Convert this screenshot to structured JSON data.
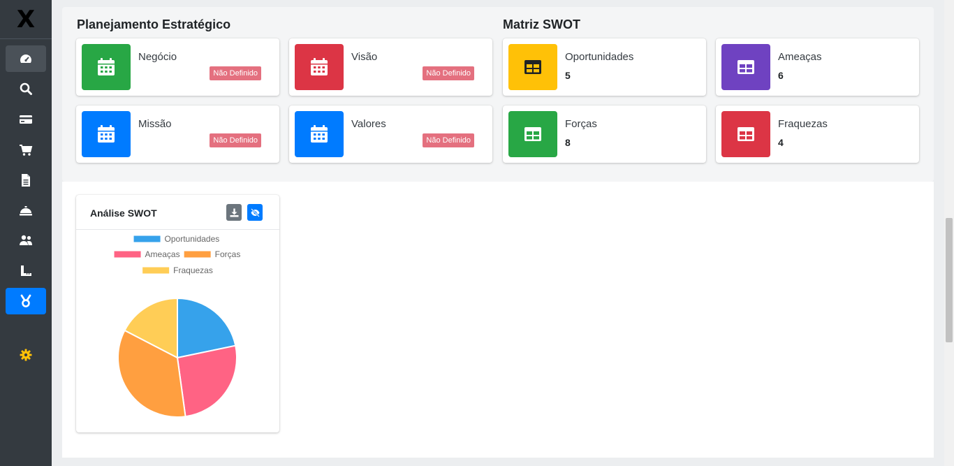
{
  "sidebar": {
    "logo": "X",
    "items": [
      {
        "icon": "tachometer-icon"
      },
      {
        "icon": "search-icon"
      },
      {
        "icon": "credit-card-icon"
      },
      {
        "icon": "shopping-cart-icon"
      },
      {
        "icon": "file-icon"
      },
      {
        "icon": "concierge-bell-icon"
      },
      {
        "icon": "users-icon"
      },
      {
        "icon": "ruler-icon"
      },
      {
        "icon": "swot-icon"
      },
      {
        "icon": "gear-icon"
      }
    ]
  },
  "planning": {
    "title": "Planejamento Estratégico",
    "items": [
      {
        "label": "Negócio",
        "status": "Não Definido",
        "color": "#28a745"
      },
      {
        "label": "Visão",
        "status": "Não Definido",
        "color": "#dc3545"
      },
      {
        "label": "Missão",
        "status": "Não Definido",
        "color": "#007bff"
      },
      {
        "label": "Valores",
        "status": "Não Definido",
        "color": "#007bff"
      }
    ]
  },
  "swot": {
    "title": "Matriz SWOT",
    "items": [
      {
        "label": "Oportunidades",
        "count": "5",
        "color": "#ffc107"
      },
      {
        "label": "Ameaças",
        "count": "6",
        "color": "#6f42c1"
      },
      {
        "label": "Forças",
        "count": "8",
        "color": "#28a745"
      },
      {
        "label": "Fraquezas",
        "count": "4",
        "color": "#dc3545"
      }
    ]
  },
  "analysis_card": {
    "title": "Análise SWOT",
    "download_icon": "download-icon",
    "hide_icon": "eye-slash-icon"
  },
  "chart_data": {
    "type": "pie",
    "title": "",
    "labels": [
      "Oportunidades",
      "Ameaças",
      "Forças",
      "Fraquezas"
    ],
    "values": [
      5,
      6,
      8,
      4
    ],
    "colors": [
      "#36a2eb",
      "#ff6384",
      "#ff9f40",
      "#ffcd56"
    ],
    "legend": "top"
  }
}
